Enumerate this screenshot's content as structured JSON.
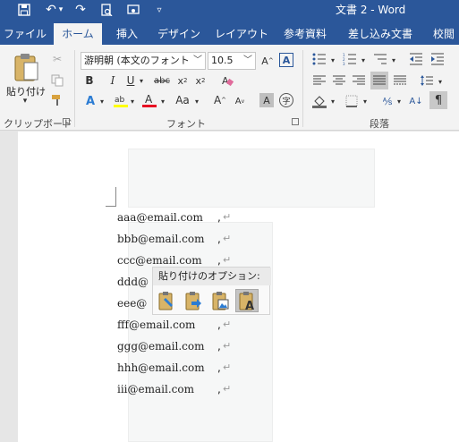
{
  "window": {
    "title": "文書 2  -  Word"
  },
  "tabs": [
    {
      "label": "ファイル",
      "active": false
    },
    {
      "label": "ホーム",
      "active": true
    },
    {
      "label": "挿入",
      "active": false
    },
    {
      "label": "デザイン",
      "active": false
    },
    {
      "label": "レイアウト",
      "active": false
    },
    {
      "label": "参考資料",
      "active": false
    },
    {
      "label": "差し込み文書",
      "active": false
    },
    {
      "label": "校閲",
      "active": false
    }
  ],
  "ribbon": {
    "clipboard": {
      "paste_label": "貼り付け",
      "group_label": "クリップボード"
    },
    "font": {
      "font_name": "游明朝 (本文のフォント",
      "font_size": "10.5",
      "group_label": "フォント"
    },
    "paragraph": {
      "group_label": "段落"
    }
  },
  "document": {
    "lines": [
      {
        "text": "aaa@email.com",
        "comma": ","
      },
      {
        "text": "bbb@email.com",
        "comma": ","
      },
      {
        "text": "ccc@email.com",
        "comma": ","
      },
      {
        "text": "ddd@",
        "comma": ""
      },
      {
        "text": "eee@",
        "comma": ""
      },
      {
        "text": "fff@email.com",
        "comma": ","
      },
      {
        "text": "ggg@email.com",
        "comma": ","
      },
      {
        "text": "hhh@email.com",
        "comma": ","
      },
      {
        "text": "iii@email.com",
        "comma": ","
      }
    ],
    "paragraph_mark": "↵"
  },
  "paste_options": {
    "title": "貼り付けのオプション:",
    "buttons": [
      "keep-source-formatting",
      "merge-formatting",
      "picture",
      "keep-text-only"
    ],
    "selected": "keep-text-only"
  },
  "colors": {
    "accent": "#2b579a",
    "ribbon_bg": "#f3f3f3",
    "highlight": "#ffff00",
    "font_color": "#e81123"
  }
}
